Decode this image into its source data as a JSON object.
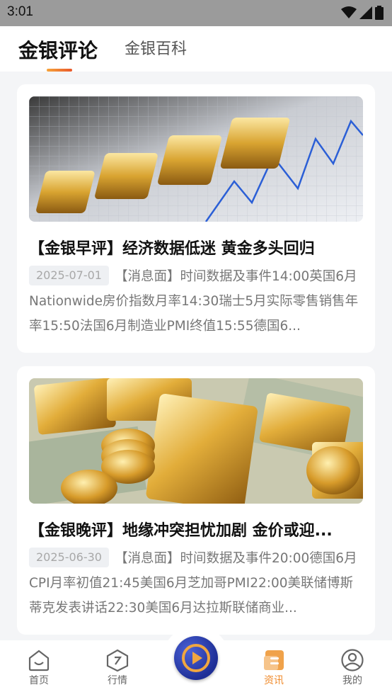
{
  "status_bar": {
    "time": "3:01"
  },
  "tabs": [
    {
      "label": "金银评论",
      "active": true
    },
    {
      "label": "金银百科",
      "active": false
    }
  ],
  "articles": [
    {
      "image": "gold-bars-chart-image",
      "title": "【金银早评】经济数据低迷 黄金多头回归",
      "date": "2025-07-01",
      "summary": "【消息面】时间数据及事件14:00英国6月Nationwide房价指数月率14:30瑞士5月实际零售销售年率15:50法国6月制造业PMI终值15:55德国6..."
    },
    {
      "image": "gold-bars-coins-dollars-image",
      "title": "【金银晚评】地缘冲突担忧加剧 金价或迎...",
      "date": "2025-06-30",
      "summary": "【消息面】时间数据及事件20:00德国6月CPI月率初值21:45美国6月芝加哥PMI22:00美联储博斯蒂克发表讲话22:30美国6月达拉斯联储商业..."
    }
  ],
  "bottom_nav": [
    {
      "label": "首页",
      "icon": "home-icon",
      "active": false
    },
    {
      "label": "行情",
      "icon": "market-icon",
      "active": false
    },
    {
      "label": "",
      "icon": "play-icon",
      "active": false
    },
    {
      "label": "资讯",
      "icon": "news-icon",
      "active": true
    },
    {
      "label": "我的",
      "icon": "profile-icon",
      "active": false
    }
  ],
  "colors": {
    "accent": "#f08a2a",
    "play_button": "#2a3bb0"
  }
}
